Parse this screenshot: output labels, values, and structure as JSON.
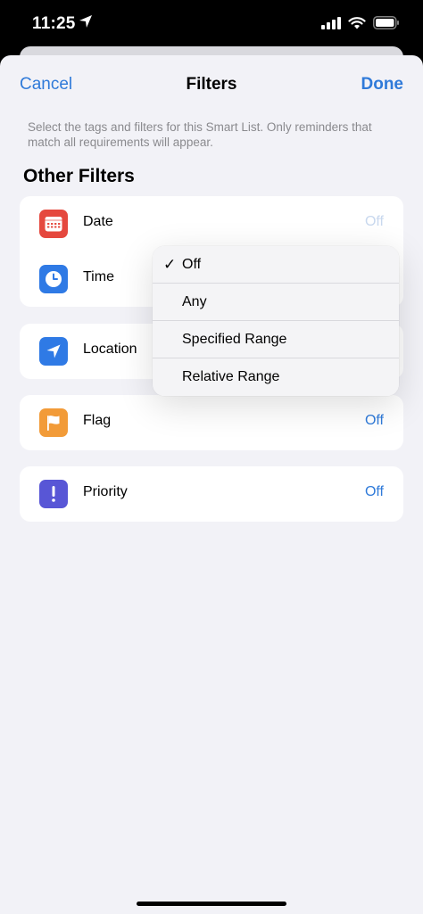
{
  "status": {
    "time": "11:25"
  },
  "nav": {
    "cancel": "Cancel",
    "title": "Filters",
    "done": "Done"
  },
  "hint": "Select the tags and filters for this Smart List. Only reminders that match all requirements will appear.",
  "section_title": "Other Filters",
  "rows": [
    {
      "label": "Date",
      "value": "Off",
      "icon": "calendar-icon",
      "color": "#e5483e"
    },
    {
      "label": "Time",
      "value": "",
      "icon": "clock-icon",
      "color": "#2f7ae5"
    },
    {
      "label": "Location",
      "value": "",
      "icon": "location-arrow-icon",
      "color": "#2f7ae5"
    },
    {
      "label": "Flag",
      "value": "Off",
      "icon": "flag-icon",
      "color": "#f29b38"
    },
    {
      "label": "Priority",
      "value": "Off",
      "icon": "exclamation-icon",
      "color": "#5856d6"
    }
  ],
  "menu": {
    "items": [
      {
        "label": "Off",
        "checked": true
      },
      {
        "label": "Any",
        "checked": false
      },
      {
        "label": "Specified Range",
        "checked": false
      },
      {
        "label": "Relative Range",
        "checked": false
      }
    ],
    "check_glyph": "✓"
  },
  "colors": {
    "accent": "#2f7ad9",
    "background": "#f2f2f7"
  }
}
